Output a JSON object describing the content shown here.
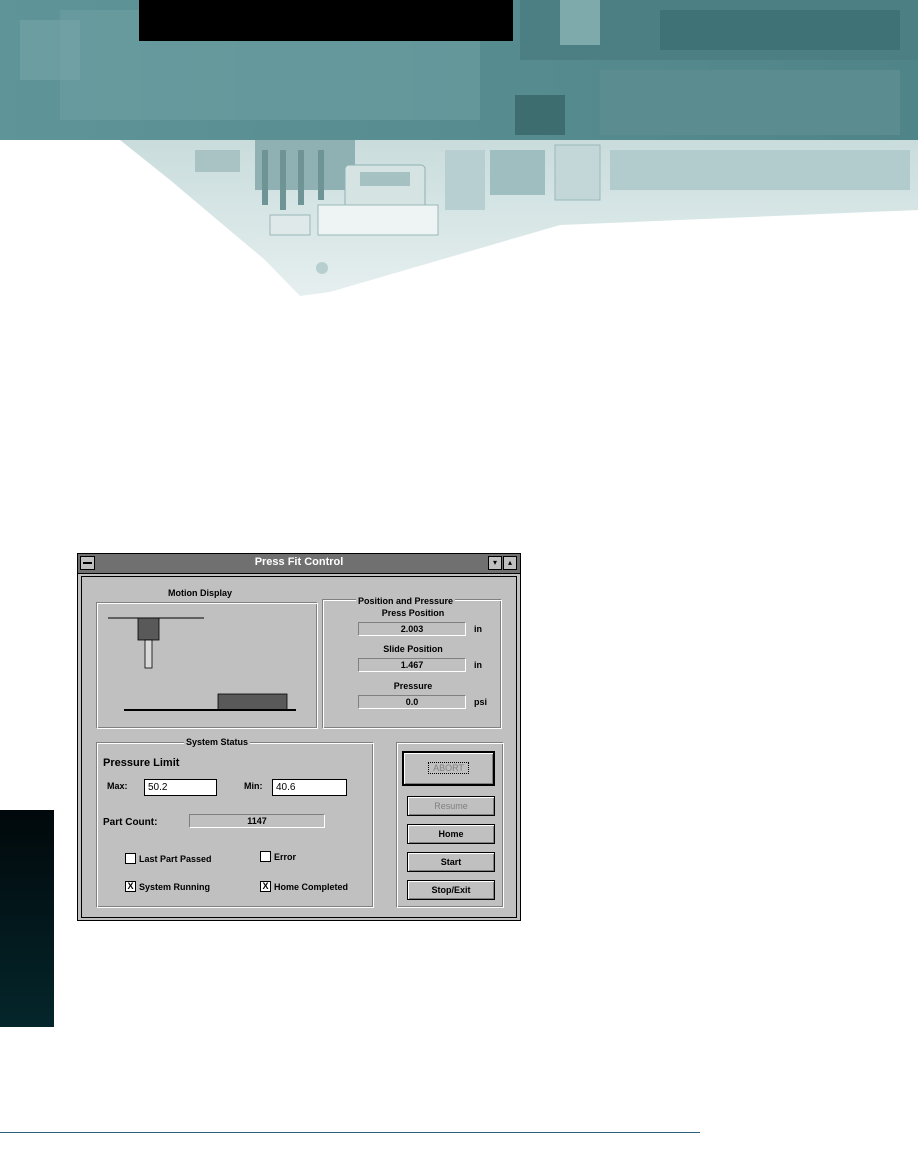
{
  "window": {
    "title": "Press Fit Control",
    "min_glyph": "▾",
    "max_glyph": "▴"
  },
  "motion_display": {
    "title": "Motion Display"
  },
  "position_pressure": {
    "title": "Position and Pressure",
    "press_position": {
      "label": "Press Position",
      "value": "2.003",
      "unit": "in"
    },
    "slide_position": {
      "label": "Slide Position",
      "value": "1.467",
      "unit": "in"
    },
    "pressure": {
      "label": "Pressure",
      "value": "0.0",
      "unit": "psi"
    }
  },
  "system_status": {
    "title": "System Status",
    "pressure_limit_label": "Pressure Limit",
    "max_label": "Max:",
    "max_value": "50.2",
    "min_label": "Min:",
    "min_value": "40.6",
    "part_count_label": "Part Count:",
    "part_count_value": "1147",
    "checks": {
      "last_part_passed": {
        "label": "Last Part Passed",
        "checked": false,
        "mark": ""
      },
      "error": {
        "label": "Error",
        "checked": false,
        "mark": ""
      },
      "system_running": {
        "label": "System Running",
        "checked": true,
        "mark": "X"
      },
      "home_completed": {
        "label": "Home Completed",
        "checked": true,
        "mark": "X"
      }
    }
  },
  "buttons": {
    "abort": "ABORT",
    "resume": "Resume",
    "home": "Home",
    "start": "Start",
    "stop_exit": "Stop/Exit"
  },
  "colors": {
    "window_face": "#c0c0c0",
    "title_bar": "#707070",
    "banner_teal": "#5a8e92"
  }
}
